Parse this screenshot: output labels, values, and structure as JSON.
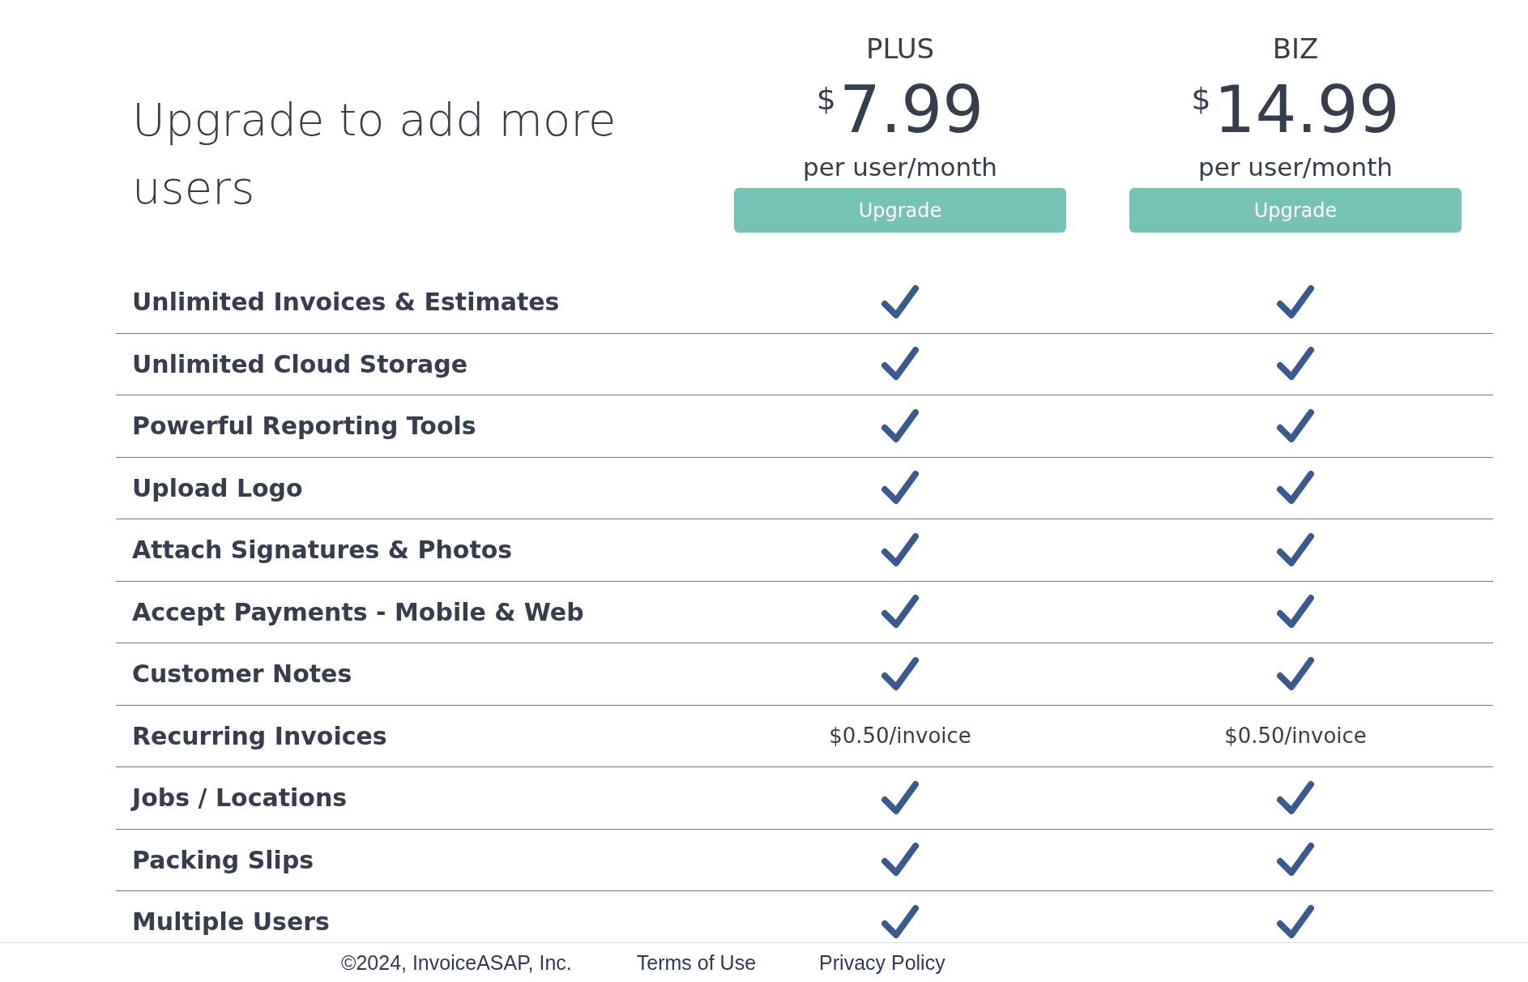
{
  "title": "Upgrade to add more users",
  "plans": [
    {
      "name": "PLUS",
      "currency": "$",
      "price": "7.99",
      "period": "per user/month",
      "button": "Upgrade"
    },
    {
      "name": "BIZ",
      "currency": "$",
      "price": "14.99",
      "period": "per user/month",
      "button": "Upgrade"
    }
  ],
  "features": [
    {
      "label": "Unlimited Invoices & Estimates",
      "cells": [
        {
          "kind": "check"
        },
        {
          "kind": "check"
        }
      ]
    },
    {
      "label": "Unlimited Cloud Storage",
      "cells": [
        {
          "kind": "check"
        },
        {
          "kind": "check"
        }
      ]
    },
    {
      "label": "Powerful Reporting Tools",
      "cells": [
        {
          "kind": "check"
        },
        {
          "kind": "check"
        }
      ]
    },
    {
      "label": "Upload Logo",
      "cells": [
        {
          "kind": "check"
        },
        {
          "kind": "check"
        }
      ]
    },
    {
      "label": "Attach Signatures & Photos",
      "cells": [
        {
          "kind": "check"
        },
        {
          "kind": "check"
        }
      ]
    },
    {
      "label": "Accept Payments - Mobile & Web",
      "cells": [
        {
          "kind": "check"
        },
        {
          "kind": "check"
        }
      ]
    },
    {
      "label": "Customer Notes",
      "cells": [
        {
          "kind": "check"
        },
        {
          "kind": "check"
        }
      ]
    },
    {
      "label": "Recurring Invoices",
      "cells": [
        {
          "kind": "text",
          "text": "$0.50/invoice"
        },
        {
          "kind": "text",
          "text": "$0.50/invoice"
        }
      ]
    },
    {
      "label": "Jobs / Locations",
      "cells": [
        {
          "kind": "check"
        },
        {
          "kind": "check"
        }
      ]
    },
    {
      "label": "Packing Slips",
      "cells": [
        {
          "kind": "check"
        },
        {
          "kind": "check"
        }
      ]
    },
    {
      "label": "Multiple Users",
      "cells": [
        {
          "kind": "check"
        },
        {
          "kind": "check"
        }
      ]
    }
  ],
  "footer": {
    "copyright": "©2024, InvoiceASAP, Inc.",
    "links": [
      "Terms of Use",
      "Privacy Policy"
    ]
  }
}
